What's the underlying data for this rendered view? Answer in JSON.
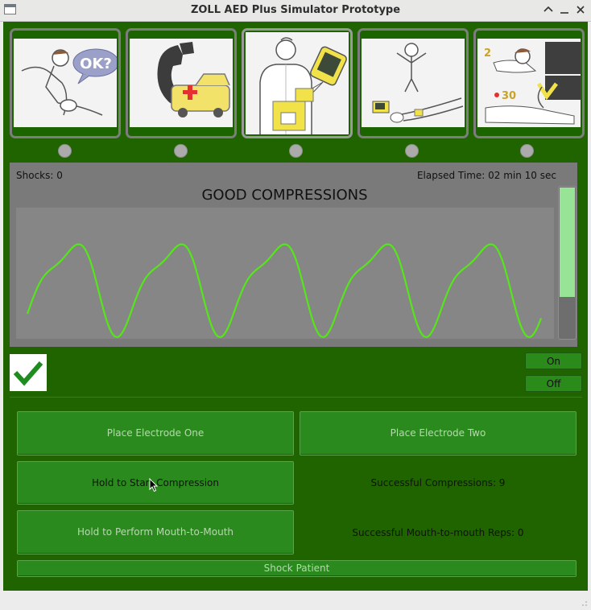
{
  "window": {
    "title": "ZOLL AED Plus Simulator Prototype"
  },
  "steps": [
    {
      "name": "check-responsiveness",
      "caption": "OK?"
    },
    {
      "name": "call-for-help"
    },
    {
      "name": "attach-pads"
    },
    {
      "name": "stand-clear"
    },
    {
      "name": "cpr",
      "caption_a": "2",
      "caption_b": "30"
    }
  ],
  "monitor": {
    "shocks_text": "Shocks: 0",
    "elapsed_text": "Elapsed Time: 02 min 10 sec",
    "status": "GOOD COMPRESSIONS",
    "depth_level": 0.72
  },
  "controls": {
    "on_label": "On",
    "off_label": "Off",
    "place_electrode_one": "Place Electrode One",
    "place_electrode_two": "Place Electrode Two",
    "hold_compression": "Hold to Start Compression",
    "successful_compressions": "Successful Compressions: 9",
    "hold_mouth": "Hold to Perform Mouth-to-Mouth",
    "successful_mouth": "Successful Mouth-to-mouth Reps: 0",
    "shock_patient": "Shock Patient"
  },
  "colors": {
    "background": "#206400",
    "waveform": "#55e61a",
    "check": "#1e8c1e"
  }
}
